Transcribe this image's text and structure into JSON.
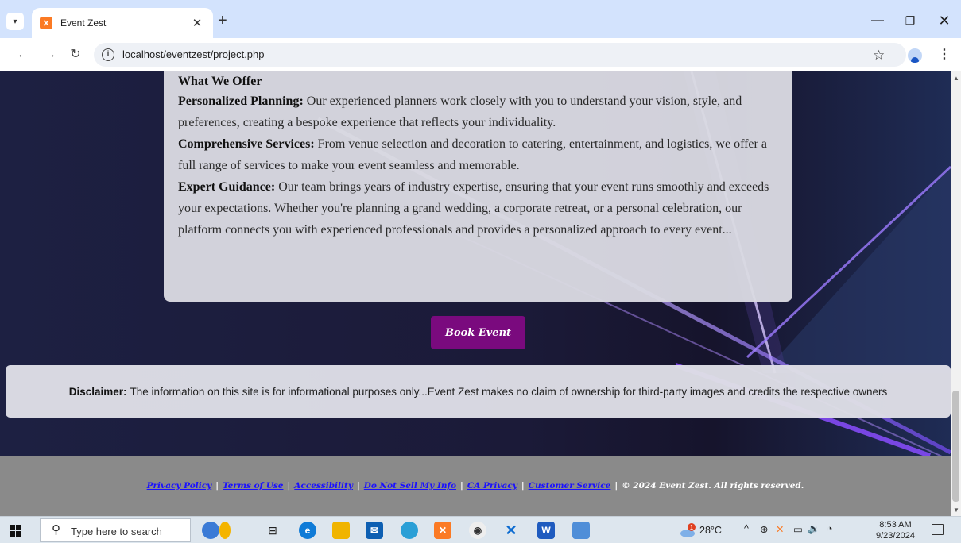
{
  "browser": {
    "tab_title": "Event Zest",
    "url": "localhost/eventzest/project.php"
  },
  "page": {
    "card": {
      "heading": "What We Offer",
      "items": [
        {
          "label": "Personalized Planning:",
          "text": " Our experienced planners work closely with you to understand your vision, style, and preferences, creating a bespoke experience that reflects your individuality."
        },
        {
          "label": "Comprehensive Services:",
          "text": " From venue selection and decoration to catering, entertainment, and logistics, we offer a full range of services to make your event seamless and memorable."
        },
        {
          "label": "Expert Guidance:",
          "text": " Our team brings years of industry expertise, ensuring that your event runs smoothly and exceeds your expectations. Whether you're planning a grand wedding, a corporate retreat, or a personal celebration, our platform connects you with experienced professionals and provides a personalized approach to every event..."
        }
      ]
    },
    "book_button": "Book Event",
    "disclaimer": {
      "label": "Disclaimer:",
      "text": "The information on this site is for informational purposes only...Event Zest makes no claim of ownership for third-party images and credits the respective owners"
    },
    "footer": {
      "links": [
        "Privacy Policy",
        "Terms of Use",
        "Accessibility",
        "Do Not Sell My Info",
        "CA Privacy",
        "Customer Service"
      ],
      "separator": "|",
      "copyright": "© 2024 Event Zest. All rights reserved."
    }
  },
  "taskbar": {
    "search_placeholder": "Type here to search",
    "temperature": "28°C",
    "weather_badge": "1",
    "time": "8:53 AM",
    "date": "9/23/2024"
  },
  "colors": {
    "book_button": "#7a0a7e",
    "footer_bg": "#8a8a8a",
    "footer_link": "#1a10ff",
    "tab_bar": "#d3e3fd"
  }
}
